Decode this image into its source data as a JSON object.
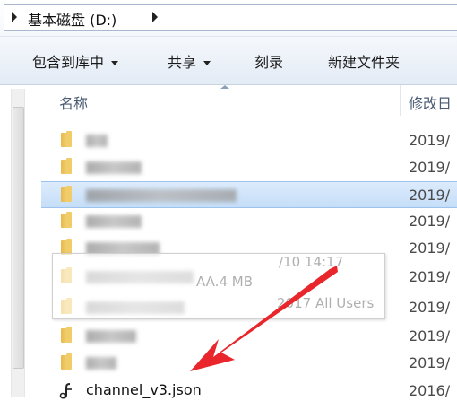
{
  "address_bar": {
    "path": "基本磁盘 (D:)"
  },
  "toolbar": {
    "include_in_library": "包含到库中",
    "share": "共享",
    "burn": "刻录",
    "new_folder": "新建文件夹"
  },
  "columns": {
    "name": "名称",
    "date_modified": "修改日"
  },
  "rows": [
    {
      "name_width": 24,
      "date": "2019/"
    },
    {
      "name_width": 62,
      "date": "2019/"
    },
    {
      "name_width": 168,
      "date": "2019/"
    },
    {
      "name_width": 62,
      "date": "2019/"
    },
    {
      "name_width": 82,
      "date": "2019/"
    },
    {
      "name_width": 120,
      "date": "2019/"
    },
    {
      "name_width": 110,
      "date": "2019/"
    },
    {
      "name_width": 56,
      "date": "2019/"
    },
    {
      "name_width": 34,
      "date": "2019/"
    }
  ],
  "file_row": {
    "name": "channel_v3.json",
    "date": "2016/"
  },
  "tooltip": {
    "line1": "/10 14:17",
    "line2": "AA.4 MB",
    "line3": "2017 All Users"
  },
  "colors": {
    "selection": "#cce4fb",
    "annotation_arrow": "#e8262b",
    "folder": "#f2c95c"
  }
}
